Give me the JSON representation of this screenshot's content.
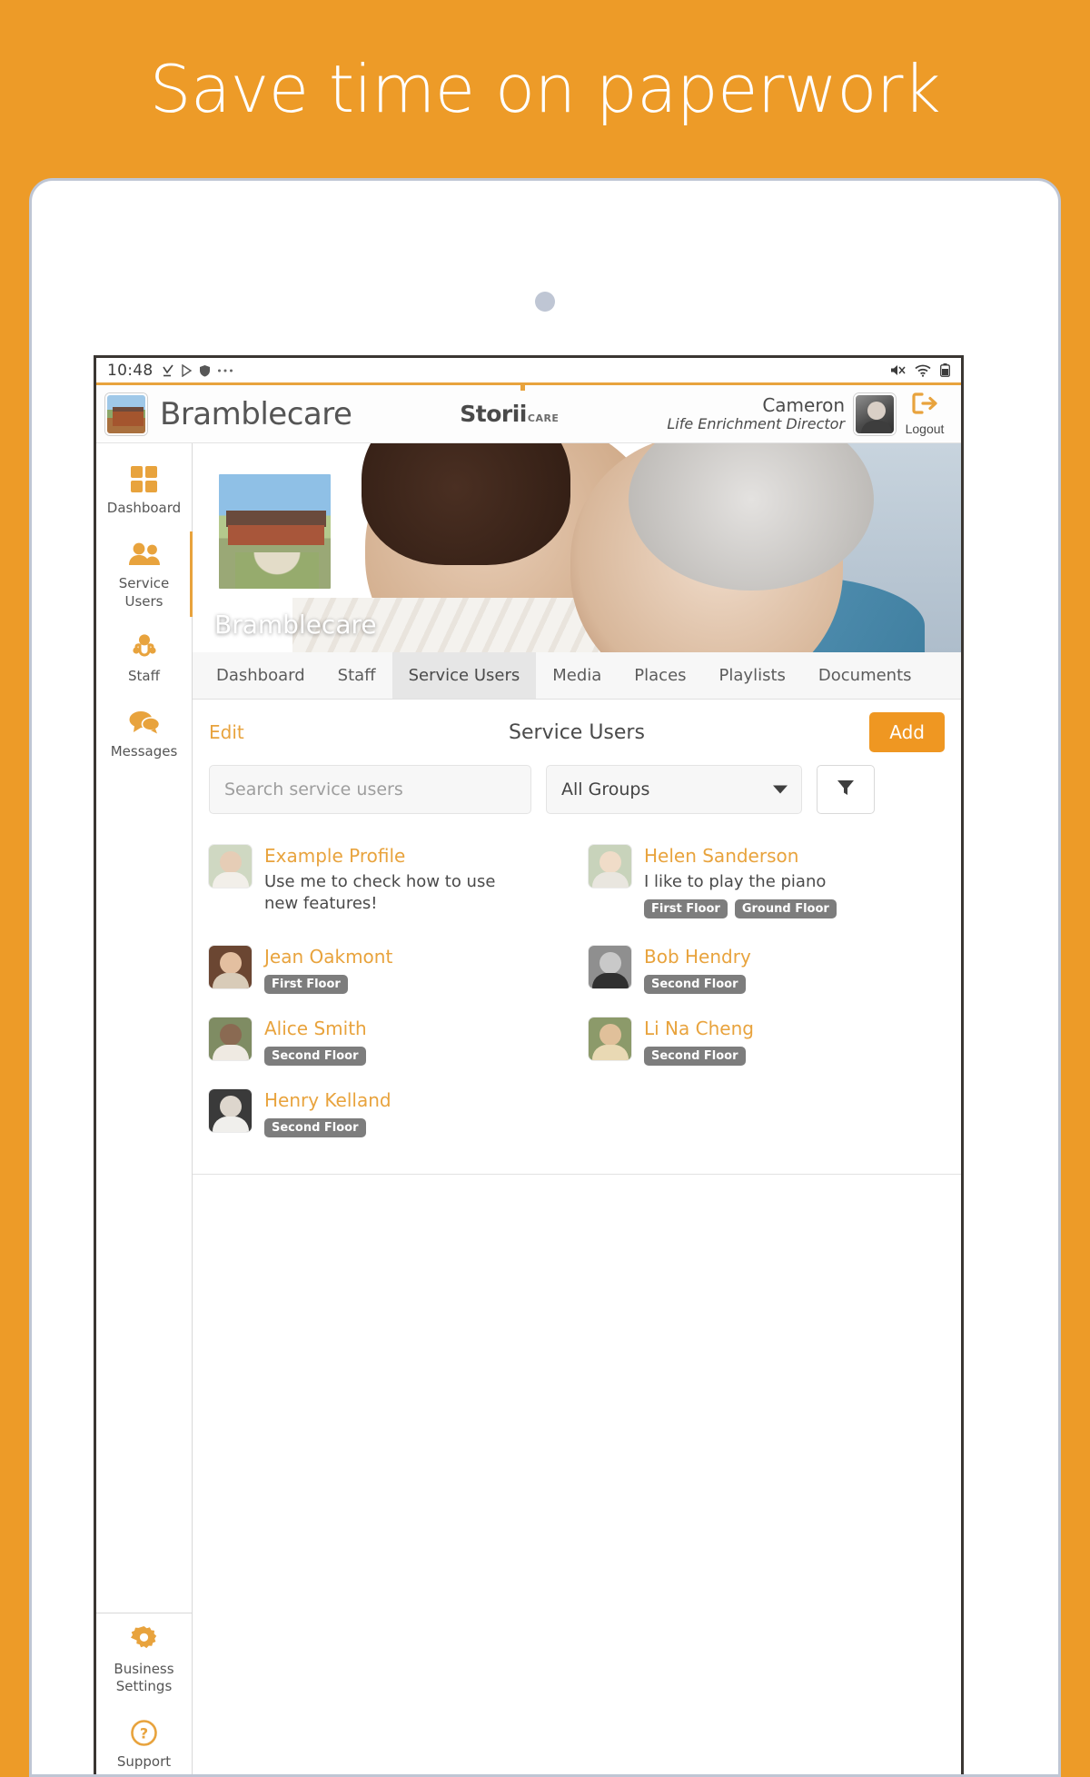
{
  "promo": {
    "headline": "Save time on paperwork"
  },
  "statusbar": {
    "time": "10:48",
    "left_icons": [
      "download-complete-icon",
      "play-store-icon",
      "shield-icon",
      "more-dots-icon"
    ],
    "right_icons": [
      "mute-icon",
      "wifi-icon",
      "battery-icon"
    ]
  },
  "header": {
    "brand_thumb": "care-home-photo",
    "brand_name": "Bramblecare",
    "product_logo": {
      "word": "Stori",
      "i": "i",
      "suffix": "CARE"
    },
    "user_name": "Cameron",
    "user_role": "Life Enrichment Director",
    "avatar": "cameron-avatar",
    "logout_label": "Logout"
  },
  "sidebar": {
    "top_items": [
      {
        "label": "Dashboard",
        "icon": "grid-icon",
        "active": false
      },
      {
        "label": "Service\nUsers",
        "icon": "people-icon",
        "active": true
      },
      {
        "label": "Staff",
        "icon": "staff-stethoscope-icon",
        "active": false
      },
      {
        "label": "Messages",
        "icon": "chat-bubbles-icon",
        "active": false
      }
    ],
    "bottom_items": [
      {
        "label": "Business\nSettings",
        "icon": "gear-icon"
      },
      {
        "label": "Support",
        "icon": "question-circle-icon"
      }
    ]
  },
  "hero": {
    "title": "Bramblecare",
    "thumbnail": "care-home-building-photo",
    "banner_image": "carer-and-resident-photo"
  },
  "tabs": [
    {
      "label": "Dashboard",
      "active": false
    },
    {
      "label": "Staff",
      "active": false
    },
    {
      "label": "Service Users",
      "active": true
    },
    {
      "label": "Media",
      "active": false
    },
    {
      "label": "Places",
      "active": false
    },
    {
      "label": "Playlists",
      "active": false
    },
    {
      "label": "Documents",
      "active": false
    }
  ],
  "panel": {
    "edit_label": "Edit",
    "title": "Service Users",
    "add_label": "Add",
    "search_placeholder": "Search service users",
    "search_value": "",
    "group_selected": "All Groups",
    "group_options": [
      "All Groups"
    ],
    "filter_icon": "funnel-icon"
  },
  "service_users": [
    {
      "name": "Example Profile",
      "description": "Use me to check how to use new features!",
      "tags": [],
      "avatar": "elderly-woman-smiling"
    },
    {
      "name": "Helen Sanderson",
      "description": "I like to play the piano",
      "tags": [
        "First Floor",
        "Ground Floor"
      ],
      "avatar": "elderly-woman-white-hair"
    },
    {
      "name": "Jean Oakmont",
      "description": "",
      "tags": [
        "First Floor"
      ],
      "avatar": "woman-with-baby"
    },
    {
      "name": "Bob Hendry",
      "description": "",
      "tags": [
        "Second Floor"
      ],
      "avatar": "elderly-man-bw"
    },
    {
      "name": "Alice Smith",
      "description": "",
      "tags": [
        "Second Floor"
      ],
      "avatar": "elderly-woman-glasses"
    },
    {
      "name": "Li Na Cheng",
      "description": "",
      "tags": [
        "Second Floor"
      ],
      "avatar": "elderly-asian-woman"
    },
    {
      "name": "Henry Kelland",
      "description": "",
      "tags": [
        "Second Floor"
      ],
      "avatar": "elderly-man-glasses"
    }
  ],
  "colors": {
    "brand_orange": "#ED9B28",
    "accent_orange": "#E8A33D",
    "add_button": "#EF9722",
    "tag_gray": "#7d7d7d",
    "text_gray": "#4a4a4a",
    "card_border": "#BFC6D4"
  },
  "avatar_palettes": [
    {
      "head": "#e6cdb6",
      "torso": "#f2efe9",
      "bg": "#cfd8c2"
    },
    {
      "head": "#f0dcc8",
      "torso": "#e9e6df",
      "bg": "#c8d3bb"
    },
    {
      "head": "#e3bfa0",
      "torso": "#d8cbb8",
      "bg": "#6b4632"
    },
    {
      "head": "#c9c9c9",
      "torso": "#2f2f2f",
      "bg": "#8f8f8f"
    },
    {
      "head": "#8a6a52",
      "torso": "#efeae2",
      "bg": "#7f8c63"
    },
    {
      "head": "#e0c09a",
      "torso": "#e9d9b4",
      "bg": "#8c9a6a"
    },
    {
      "head": "#ddd6cd",
      "torso": "#f0efec",
      "bg": "#3a3a3a"
    }
  ]
}
